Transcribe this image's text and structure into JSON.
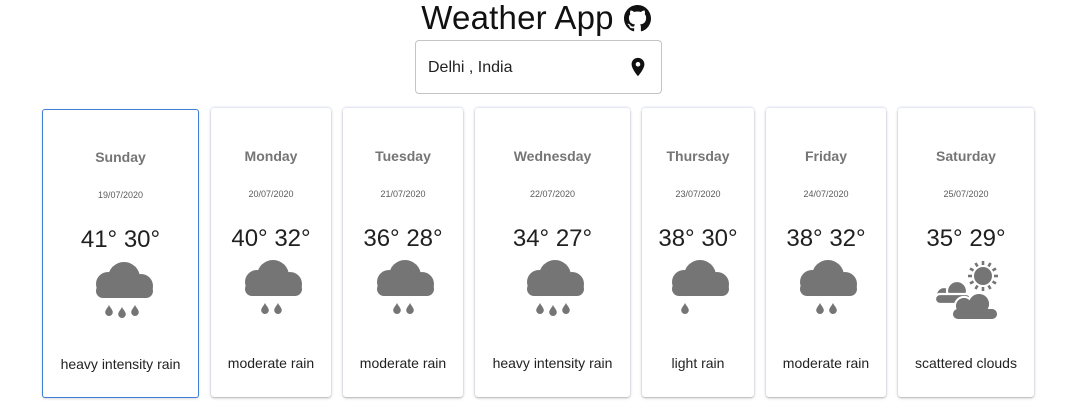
{
  "header": {
    "title": "Weather App",
    "github_icon": "github-icon"
  },
  "search": {
    "value": "Delhi , India",
    "location_icon": "location-pin-icon"
  },
  "forecast": [
    {
      "day": "Sunday",
      "date": "19/07/2020",
      "high": "41°",
      "low": "30°",
      "icon": "heavy-rain-cloud-icon",
      "description": "heavy intensity rain",
      "selected": true
    },
    {
      "day": "Monday",
      "date": "20/07/2020",
      "high": "40°",
      "low": "32°",
      "icon": "rain-cloud-icon",
      "description": "moderate rain",
      "selected": false
    },
    {
      "day": "Tuesday",
      "date": "21/07/2020",
      "high": "36°",
      "low": "28°",
      "icon": "rain-cloud-icon",
      "description": "moderate rain",
      "selected": false
    },
    {
      "day": "Wednesday",
      "date": "22/07/2020",
      "high": "34°",
      "low": "27°",
      "icon": "heavy-rain-cloud-icon",
      "description": "heavy intensity rain",
      "selected": false
    },
    {
      "day": "Thursday",
      "date": "23/07/2020",
      "high": "38°",
      "low": "30°",
      "icon": "light-rain-cloud-icon",
      "description": "light rain",
      "selected": false
    },
    {
      "day": "Friday",
      "date": "24/07/2020",
      "high": "38°",
      "low": "32°",
      "icon": "rain-cloud-icon",
      "description": "moderate rain",
      "selected": false
    },
    {
      "day": "Saturday",
      "date": "25/07/2020",
      "high": "35°",
      "low": "29°",
      "icon": "sun-clouds-icon",
      "description": "scattered clouds",
      "selected": false
    }
  ],
  "colors": {
    "icon_gray": "#757575",
    "selected_border": "#3f7fd8"
  }
}
